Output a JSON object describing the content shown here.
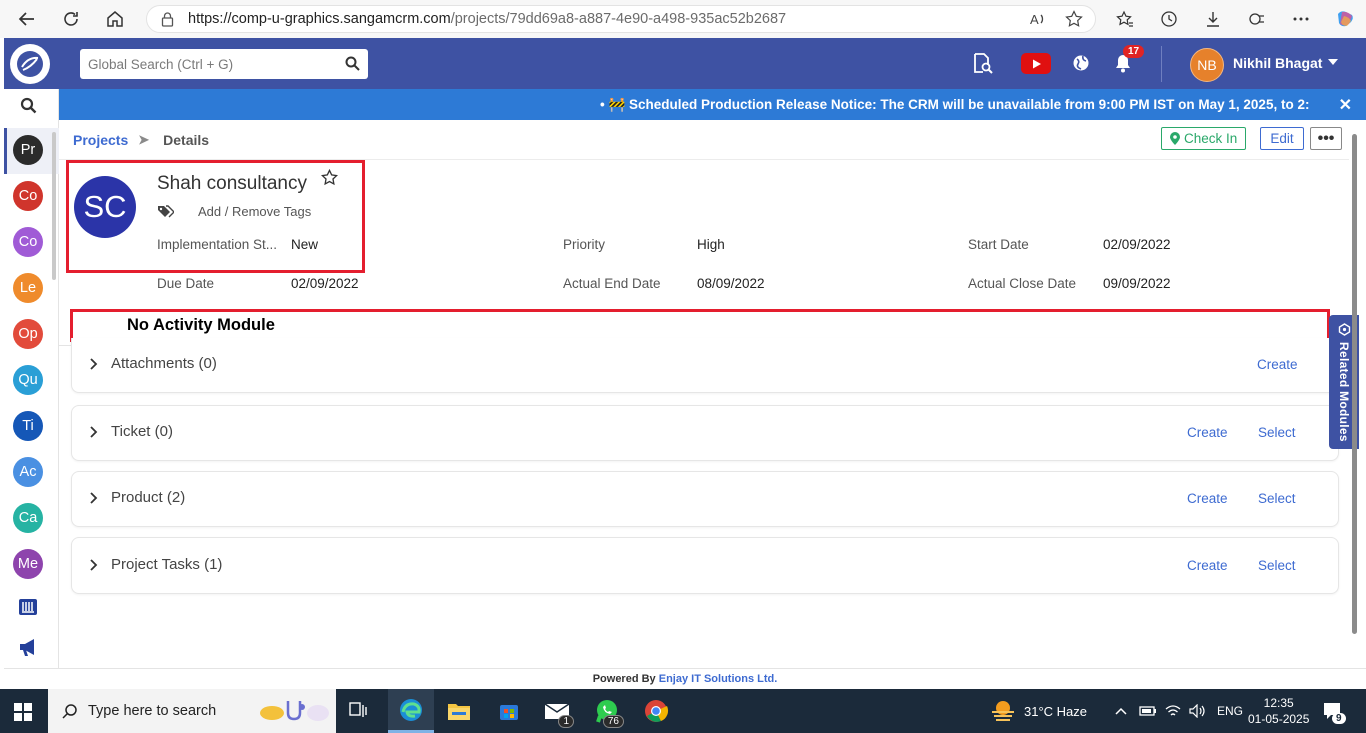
{
  "browser": {
    "url_host": "https://comp-u-graphics.sangamcrm.com",
    "url_path": "/projects/79dd69a8-a887-4e90-a498-935ac52b2687"
  },
  "topbar": {
    "search_placeholder": "Global Search (Ctrl + G)",
    "notification_count": "17",
    "user_initials": "NB",
    "user_name": "Nikhil Bhagat"
  },
  "sidebar": {
    "modules": [
      {
        "label": "Pr",
        "color": "#2b2b2b"
      },
      {
        "label": "Co",
        "color": "#d0352c"
      },
      {
        "label": "Co",
        "color": "#a05bd6"
      },
      {
        "label": "Le",
        "color": "#ef8b2c"
      },
      {
        "label": "Op",
        "color": "#e24b3b"
      },
      {
        "label": "Qu",
        "color": "#2a9fd6"
      },
      {
        "label": "Ti",
        "color": "#1557b7"
      },
      {
        "label": "Ac",
        "color": "#4a90e2"
      },
      {
        "label": "Ca",
        "color": "#26b3a3"
      },
      {
        "label": "Me",
        "color": "#8e44ad"
      }
    ]
  },
  "notice": {
    "text": "• 🚧 Scheduled Production Release Notice: The CRM will be unavailable from 9:00 PM IST on May 1, 2025, to 2:"
  },
  "breadcrumb": {
    "parent": "Projects",
    "current": "Details"
  },
  "actions": {
    "checkin": "Check In",
    "edit": "Edit",
    "more": "•••"
  },
  "record": {
    "initials": "SC",
    "name": "Shah consultancy",
    "tags_label": "Add / Remove Tags"
  },
  "fields": [
    {
      "label": "Implementation St...",
      "value": "New"
    },
    {
      "label": "Priority",
      "value": "High"
    },
    {
      "label": "Start Date",
      "value": "02/09/2022"
    },
    {
      "label": "Due Date",
      "value": "02/09/2022"
    },
    {
      "label": "Actual End Date",
      "value": "08/09/2022"
    },
    {
      "label": "Actual Close Date",
      "value": "09/09/2022"
    }
  ],
  "annotation": {
    "text": "No Activity Module"
  },
  "panels": [
    {
      "title": "Attachments (0)",
      "create": "Create",
      "select": ""
    },
    {
      "title": "Ticket (0)",
      "create": "Create",
      "select": "Select"
    },
    {
      "title": "Product (2)",
      "create": "Create",
      "select": "Select"
    },
    {
      "title": "Project Tasks (1)",
      "create": "Create",
      "select": "Select"
    }
  ],
  "related_modules": "Related Modules",
  "footer": {
    "prefix": "Powered By",
    "company": "Enjay IT Solutions Ltd."
  },
  "taskbar": {
    "search_placeholder": "Type here to search",
    "mail_badge": "1",
    "whatsapp_badge": "76",
    "weather": "31°C  Haze",
    "lang": "ENG",
    "time": "12:35",
    "date": "01-05-2025",
    "notif_count": "9"
  }
}
